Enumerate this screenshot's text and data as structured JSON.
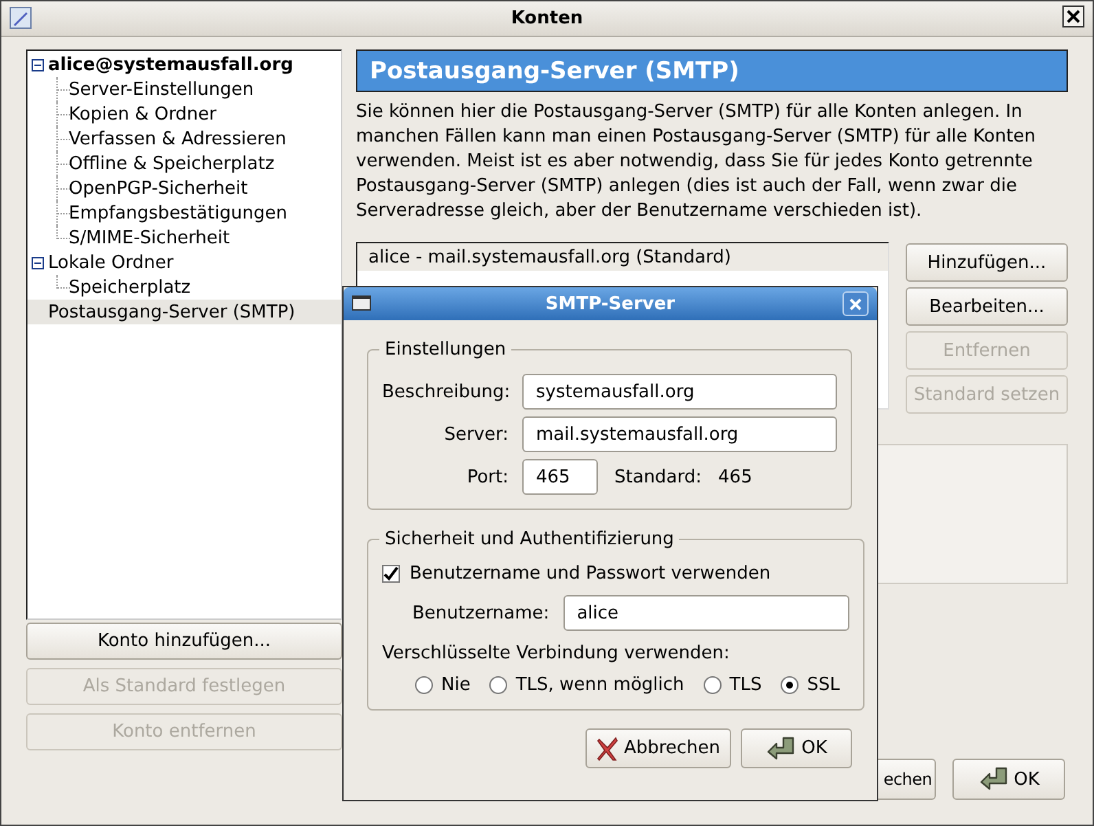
{
  "window": {
    "title": "Konten"
  },
  "tree": [
    {
      "label": "alice@systemausfall.org",
      "kind": "account",
      "expanded": true,
      "selected": false,
      "children": [
        {
          "label": "Server-Einstellungen",
          "selected": false
        },
        {
          "label": "Kopien & Ordner",
          "selected": false
        },
        {
          "label": "Verfassen & Adressieren",
          "selected": false
        },
        {
          "label": "Offline & Speicherplatz",
          "selected": false
        },
        {
          "label": "OpenPGP-Sicherheit",
          "selected": false
        },
        {
          "label": "Empfangsbestätigungen",
          "selected": false
        },
        {
          "label": "S/MIME-Sicherheit",
          "selected": false
        }
      ]
    },
    {
      "label": "Lokale Ordner",
      "kind": "folder",
      "expanded": true,
      "selected": false,
      "children": [
        {
          "label": "Speicherplatz",
          "selected": false
        }
      ]
    },
    {
      "label": "Postausgang-Server (SMTP)",
      "kind": "folder",
      "selected": true
    }
  ],
  "account_buttons": [
    {
      "label": "Konto hinzufügen...",
      "disabled": false
    },
    {
      "label": "Als Standard festlegen",
      "disabled": true
    },
    {
      "label": "Konto entfernen",
      "disabled": true
    }
  ],
  "panel": {
    "title": "Postausgang-Server (SMTP)",
    "description": "Sie können hier die Postausgang-Server (SMTP) für alle Konten anlegen. In manchen Fällen kann man einen Postausgang-Server (SMTP) für alle Konten verwenden. Meist ist es aber notwendig, dass Sie für jedes Konto getrennte Postausgang-Server (SMTP) anlegen (dies ist auch der Fall, wenn zwar die Serveradresse gleich, aber der Benutzername verschieden ist).",
    "servers": [
      {
        "label": "alice - mail.systemausfall.org (Standard)",
        "selected": true
      }
    ],
    "server_buttons": [
      {
        "label": "Hinzufügen...",
        "disabled": false
      },
      {
        "label": "Bearbeiten...",
        "disabled": false
      },
      {
        "label": "Entfernen",
        "disabled": true
      },
      {
        "label": "Standard setzen",
        "disabled": true
      }
    ]
  },
  "buttons": [
    {
      "label": "echen",
      "kind": "plain"
    },
    {
      "label": "OK",
      "kind": "confirm"
    }
  ],
  "smtp_dialog": {
    "title": "SMTP-Server",
    "settings": {
      "legend": "Einstellungen",
      "fields": [
        {
          "label": "Beschreibung:",
          "value": "systemausfall.org"
        },
        {
          "label": "Server:",
          "value": "mail.systemausfall.org"
        }
      ],
      "port": {
        "label": "Port:",
        "value": "465"
      },
      "default_port": {
        "label": "Standard:",
        "value": "465"
      }
    },
    "security": {
      "legend": "Sicherheit und Authentifizierung",
      "use_auth": {
        "label": "Benutzername und Passwort verwenden",
        "checked": true
      },
      "username": {
        "label": "Benutzername:",
        "value": "alice"
      },
      "encryption": {
        "label": "Verschlüsselte Verbindung verwenden:",
        "options": [
          {
            "label": "Nie",
            "selected": false
          },
          {
            "label": "TLS, wenn möglich",
            "selected": false
          },
          {
            "label": "TLS",
            "selected": false
          },
          {
            "label": "SSL",
            "selected": true
          }
        ]
      }
    },
    "buttons": [
      {
        "label": "Abbrechen",
        "kind": "cancel"
      },
      {
        "label": "OK",
        "kind": "confirm"
      }
    ]
  }
}
